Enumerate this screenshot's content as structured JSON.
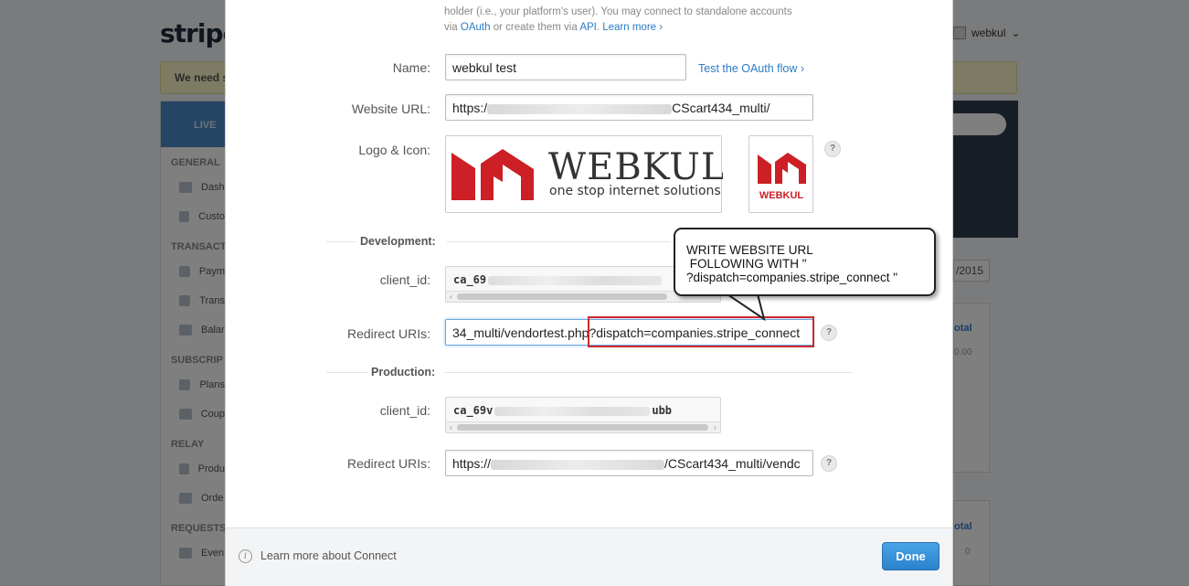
{
  "background": {
    "logo": "stripe",
    "user_name": "webkul",
    "banner_text": "We need s",
    "sidebar": {
      "live_label": "LIVE",
      "sections": [
        {
          "title": "GENERAL",
          "items": [
            "Dash",
            "Custo"
          ]
        },
        {
          "title": "TRANSACT",
          "items": [
            "Paym",
            "Trans",
            "Balar"
          ]
        },
        {
          "title": "SUBSCRIP",
          "items": [
            "Plans",
            "Coup"
          ]
        },
        {
          "title": "RELAY",
          "items": [
            "Produ",
            "Orde"
          ]
        },
        {
          "title": "REQUESTS",
          "items": [
            "Even"
          ]
        }
      ]
    },
    "date_text": "/2015",
    "card1_title": "otal",
    "card1_value": "0.00",
    "card2_title": "otal",
    "card2_value": "0"
  },
  "modal": {
    "intro_line1": "holder (i.e., your platform's user). You may connect to standalone accounts",
    "intro_via": "via ",
    "intro_oauth": "OAuth",
    "intro_or": " or create them via ",
    "intro_api": "API",
    "intro_period": ". ",
    "intro_learn_more": "Learn more ›",
    "name_label": "Name:",
    "name_value": "webkul test",
    "test_oauth_link": "Test the OAuth flow ›",
    "website_label": "Website URL:",
    "website_prefix": "https:/",
    "website_suffix": "CScart434_multi/",
    "logo_label": "Logo & Icon:",
    "logo_word": "WEBKUL",
    "logo_tagline": "one stop internet solutions",
    "icon_word": "WEBKUL",
    "help_mark": "?",
    "development_heading": "Development:",
    "dev_client_label": "client_id:",
    "dev_client_prefix": "ca_69",
    "dev_redirect_label": "Redirect URIs:",
    "dev_redirect_value_start": "34_multi/vendortest.php",
    "dev_redirect_value_highlight": "?dispatch=companies.stripe_connect",
    "production_heading": "Production:",
    "prod_client_label": "client_id:",
    "prod_client_prefix": "ca_69v",
    "prod_client_suffix": "ubb",
    "prod_redirect_label": "Redirect URIs:",
    "prod_redirect_prefix": "https://",
    "prod_redirect_suffix": "/CScart434_multi/vendc",
    "callout_text": "WRITE WEBSITE URL\n FOLLOWING WITH \"\n?dispatch=companies.stripe_connect \"",
    "footer_learn": "Learn more about Connect",
    "done_label": "Done"
  },
  "colors": {
    "accent_blue": "#2a7bc6",
    "done_button": "#3592dc",
    "highlight_red": "#cf2a2a",
    "webkul_red": "#cc1f26"
  }
}
